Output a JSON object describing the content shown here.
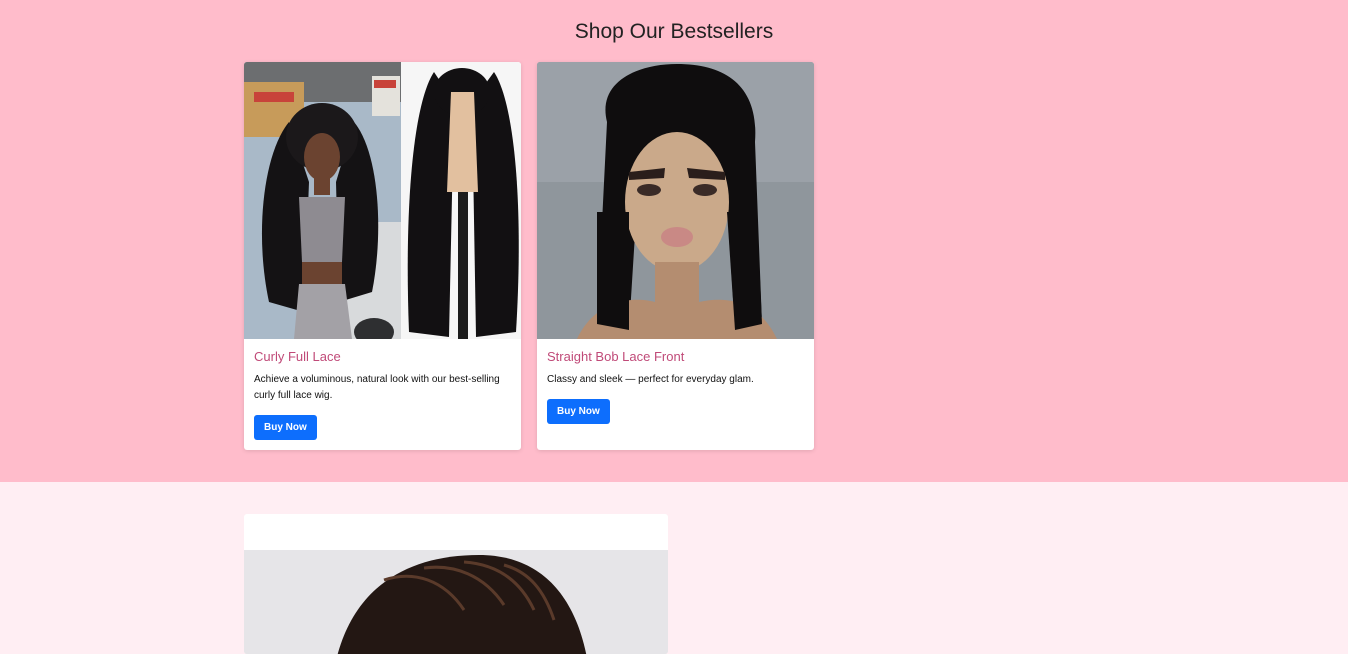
{
  "section": {
    "title": "Shop Our Bestsellers"
  },
  "products": [
    {
      "name": "Curly Full Lace",
      "description": "Achieve a voluminous, natural look with our best-selling curly full lace wig.",
      "button": "Buy Now"
    },
    {
      "name": "Straight Bob Lace Front",
      "description": "Classy and sleek — perfect for everyday glam.",
      "button": "Buy Now"
    }
  ],
  "colors": {
    "bestsellers_bg": "#ffbccb",
    "page_bg": "#ffeef3",
    "product_title": "#c04a78",
    "button": "#0d6efd"
  }
}
